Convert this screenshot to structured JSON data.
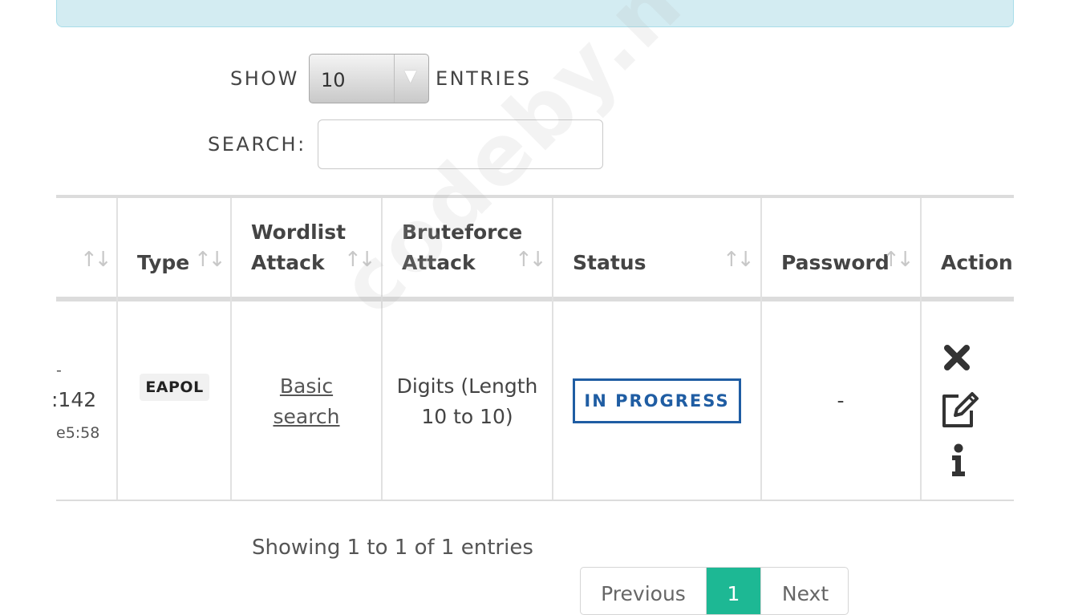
{
  "length_control": {
    "show_label": "SHOW",
    "selected_value": "10",
    "entries_label": "ENTRIES"
  },
  "search": {
    "label": "SEARCH:",
    "value": ""
  },
  "table": {
    "headers": {
      "col0": "",
      "type": "Type",
      "wordlist_line1": "Wordlist",
      "wordlist_line2": "Attack",
      "bruteforce_line1": "Bruteforce",
      "bruteforce_line2": "Attack",
      "status": "Status",
      "password": "Password",
      "action": "Action"
    },
    "rows": [
      {
        "col0_line1": "-",
        "col0_line2": ":142",
        "col0_line3": "e5:58",
        "type": "EAPOL",
        "wordlist_line1": "Basic",
        "wordlist_line2": "search",
        "bruteforce_line1": "Digits (Length",
        "bruteforce_line2": "10 to 10)",
        "status": "IN PROGRESS",
        "password": "-"
      }
    ]
  },
  "info_text": "Showing 1 to 1 of 1 entries",
  "pagination": {
    "previous": "Previous",
    "current": "1",
    "next": "Next"
  },
  "watermark": "codeby.net",
  "colors": {
    "alert_bg": "#d3ecf2",
    "status_blue": "#1f5da3",
    "page_active": "#1db894"
  },
  "icons": {
    "delete": "close-icon",
    "edit": "edit-icon",
    "info": "info-icon",
    "sort": "sort-arrows-icon",
    "dropdown": "chevron-down-icon"
  }
}
